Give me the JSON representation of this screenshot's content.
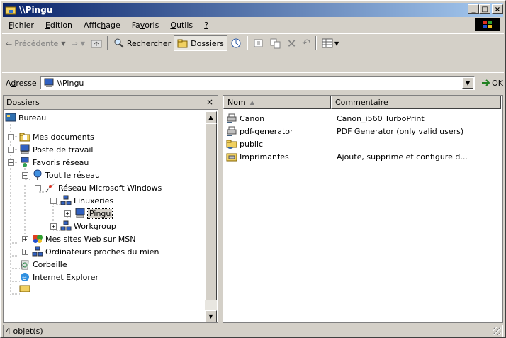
{
  "window": {
    "title": "\\\\Pingu"
  },
  "menu": [
    {
      "pre": "",
      "u": "F",
      "post": "ichier"
    },
    {
      "pre": "",
      "u": "E",
      "post": "dition"
    },
    {
      "pre": "Affic",
      "u": "h",
      "post": "age"
    },
    {
      "pre": "Fa",
      "u": "v",
      "post": "oris"
    },
    {
      "pre": "",
      "u": "O",
      "post": "utils"
    },
    {
      "pre": "",
      "u": "?",
      "post": ""
    }
  ],
  "toolbar": {
    "back": "Précédente",
    "search": "Rechercher",
    "folders": "Dossiers"
  },
  "address": {
    "label_pre": "A",
    "label_u": "d",
    "label_post": "resse",
    "value": "\\\\Pingu",
    "ok": "OK"
  },
  "folders": {
    "title": "Dossiers",
    "close": "×",
    "tree": [
      {
        "label": "Bureau"
      },
      {
        "label": "Mes documents"
      },
      {
        "label": "Poste de travail"
      },
      {
        "label": "Favoris réseau"
      },
      {
        "label": "Tout le réseau"
      },
      {
        "label": "Réseau Microsoft Windows"
      },
      {
        "label": "Linuxeries"
      },
      {
        "label": "Pingu"
      },
      {
        "label": "Workgroup"
      },
      {
        "label": "Mes sites Web sur MSN"
      },
      {
        "label": "Ordinateurs proches du mien"
      },
      {
        "label": "Corbeille"
      },
      {
        "label": "Internet Explorer"
      }
    ]
  },
  "files": {
    "columns": {
      "name": "Nom",
      "comment": "Commentaire"
    },
    "rows": [
      {
        "name": "Canon",
        "comment": "Canon_i560 TurboPrint"
      },
      {
        "name": "pdf-generator",
        "comment": "PDF Generator (only valid users)"
      },
      {
        "name": "public",
        "comment": ""
      },
      {
        "name": "Imprimantes",
        "comment": "Ajoute, supprime et configure d..."
      }
    ]
  },
  "status": {
    "text": "4 objet(s)"
  }
}
